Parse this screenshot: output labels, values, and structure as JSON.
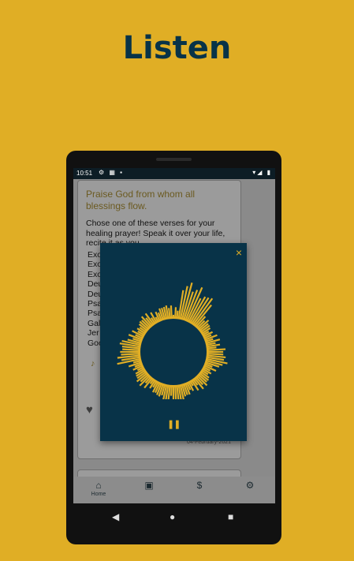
{
  "promo": {
    "title": "Listen"
  },
  "status_bar": {
    "time": "10:51",
    "left_icons": "⚙ ▦ ▪",
    "right_icons": "▾◢ ▮"
  },
  "card": {
    "title": "Praise God from whom all blessings flow.",
    "body": "Chose one of these verses for your healing prayer! Speak it over your life, recite it as you…",
    "verses": [
      "Exo",
      "Exo",
      "Exo",
      "Deu",
      "Deu",
      "Psa",
      "Psa",
      "Gal",
      "Jer",
      "Goo"
    ],
    "date": "04-February-2021"
  },
  "bottom_nav": {
    "items": [
      {
        "label": "Home",
        "icon": "home-icon"
      },
      {
        "label": "",
        "icon": "calendar-icon"
      },
      {
        "label": "",
        "icon": "dollar-icon"
      },
      {
        "label": "",
        "icon": "gear-icon"
      }
    ]
  },
  "player": {
    "close_label": "×",
    "pause_label": "❚❚"
  },
  "colors": {
    "brand_yellow": "#e0ae25",
    "brand_dark": "#083348"
  }
}
